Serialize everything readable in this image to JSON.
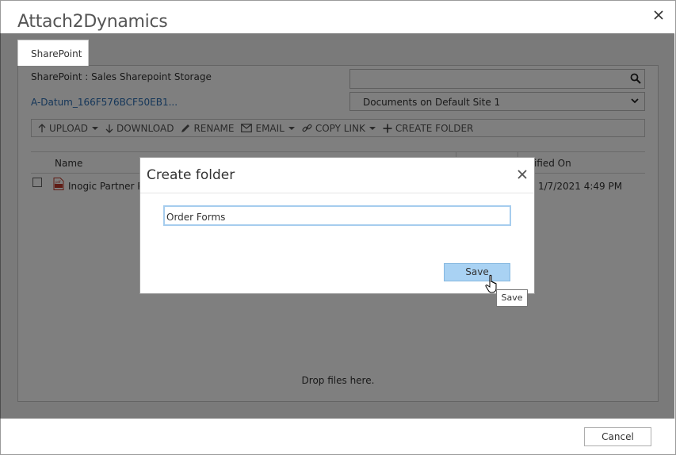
{
  "window": {
    "title": "Attach2Dynamics"
  },
  "tabs": [
    {
      "label": "SharePoint"
    }
  ],
  "sharepoint": {
    "path_label": "SharePoint : Sales Sharepoint Storage",
    "record_link": "A-Datum_166F576BCF50EB1...",
    "search_value": "",
    "site_selected": "Documents on Default Site 1"
  },
  "toolbar": {
    "upload": "UPLOAD",
    "download": "DOWNLOAD",
    "rename": "RENAME",
    "email": "EMAIL",
    "copy_link": "COPY LINK",
    "create_folder": "CREATE FOLDER"
  },
  "grid": {
    "col_name": "Name",
    "col_modified": "odified On",
    "rows": [
      {
        "name": "Inogic Partner Pro",
        "modified": "1/7/2021 4:49 PM"
      }
    ],
    "drop_text": "Drop files here."
  },
  "footer": {
    "cancel_label": "Cancel"
  },
  "dialog": {
    "title": "Create folder",
    "input_value": "Order Forms",
    "save_label": "Save",
    "tooltip": "Save"
  },
  "colors": {
    "accent": "#a9d2f3",
    "link": "#2a6db3",
    "overlay": "#000000"
  }
}
